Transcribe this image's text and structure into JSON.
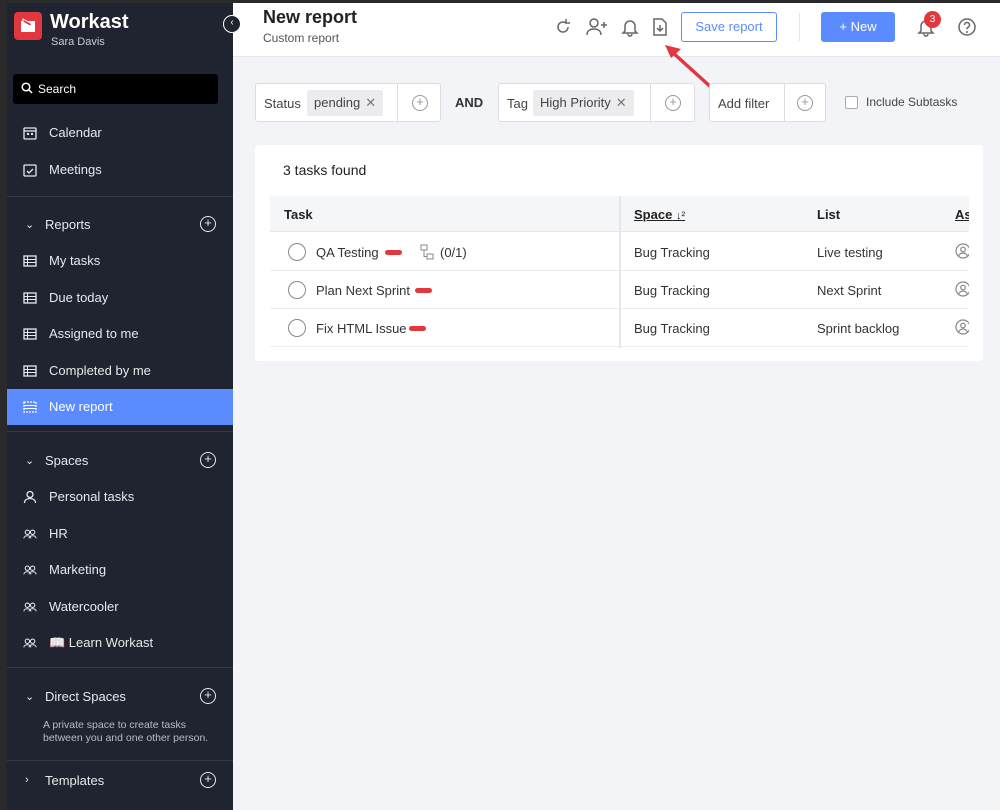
{
  "app": {
    "name": "Workast",
    "user": "Sara Davis"
  },
  "sidebar": {
    "search_label": "Search",
    "top_items": [
      {
        "label": "Calendar",
        "icon": "calendar-icon"
      },
      {
        "label": "Meetings",
        "icon": "meetings-icon"
      }
    ],
    "reports": {
      "label": "Reports",
      "items": [
        {
          "label": "My tasks"
        },
        {
          "label": "Due today"
        },
        {
          "label": "Assigned to me"
        },
        {
          "label": "Completed by me"
        },
        {
          "label": "New report",
          "active": true
        }
      ]
    },
    "spaces": {
      "label": "Spaces",
      "items": [
        {
          "label": "Personal tasks"
        },
        {
          "label": "HR"
        },
        {
          "label": "Marketing"
        },
        {
          "label": "Watercooler"
        },
        {
          "label": "📖 Learn Workast"
        }
      ]
    },
    "direct_spaces": {
      "label": "Direct Spaces",
      "description": "A private space to create tasks between you and one other person."
    },
    "templates": {
      "label": "Templates"
    }
  },
  "header": {
    "title": "New report",
    "subtitle": "Custom report",
    "save_label": "Save report",
    "new_label": "New",
    "notification_count": "3"
  },
  "filters": {
    "status_label": "Status",
    "status_value": "pending",
    "and_label": "AND",
    "tag_label": "Tag",
    "tag_value": "High Priority",
    "add_filter_label": "Add filter",
    "include_subtasks_label": "Include Subtasks"
  },
  "results": {
    "count_text": "3 tasks found",
    "columns": {
      "task": "Task",
      "space": "Space",
      "list": "List",
      "assignee": "As"
    },
    "rows": [
      {
        "task": "QA Testing",
        "subtasks": "(0/1)",
        "space": "Bug Tracking",
        "list": "Live testing"
      },
      {
        "task": "Plan Next Sprint",
        "subtasks": "",
        "space": "Bug Tracking",
        "list": "Next Sprint"
      },
      {
        "task": "Fix HTML Issue",
        "subtasks": "",
        "space": "Bug Tracking",
        "list": "Sprint backlog"
      }
    ]
  },
  "colors": {
    "sidebar_bg": "#202431",
    "accent": "#5b8cff",
    "brand_red": "#e2373f",
    "annotation_arrow": "#e2373f"
  }
}
